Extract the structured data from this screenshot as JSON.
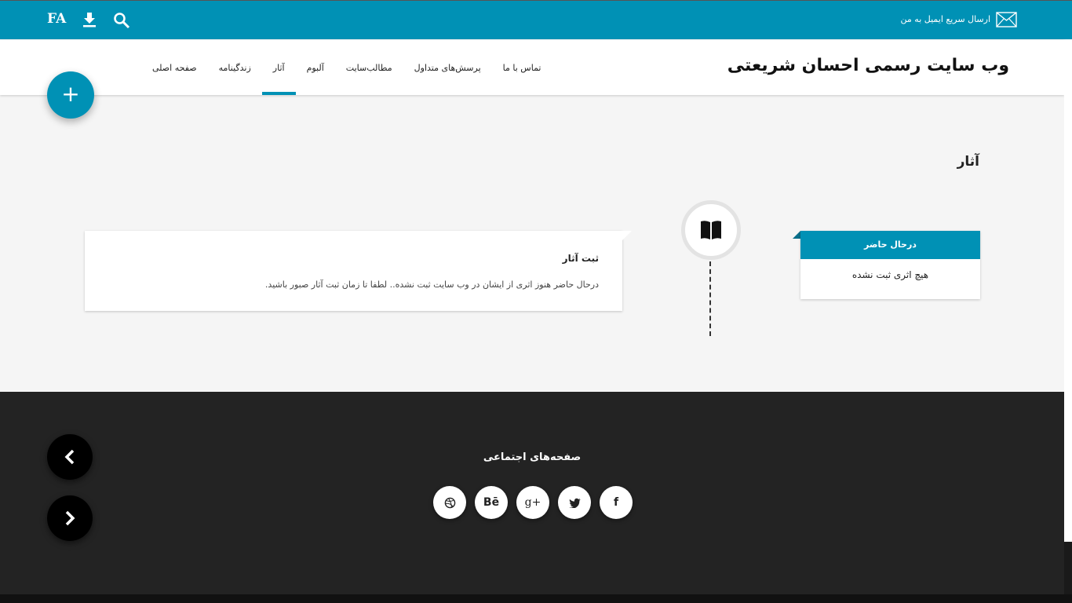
{
  "topbar": {
    "lang_label": "FA",
    "mail_text": "ارسال سریع ایمیل به من",
    "download_icon": "download-icon",
    "search_icon": "search-icon",
    "mail_icon": "envelope-icon"
  },
  "header": {
    "site_title": "وب سایت رسمی احسان شریعتی",
    "nav": [
      {
        "label": "صفحه اصلی",
        "active": false
      },
      {
        "label": "زندگینامه",
        "active": false
      },
      {
        "label": "آثار",
        "active": true
      },
      {
        "label": "آلبوم",
        "active": false
      },
      {
        "label": "مطالب‌سایت",
        "active": false
      },
      {
        "label": "پرسش‌های متداول",
        "active": false
      },
      {
        "label": "تماس با ما",
        "active": false
      }
    ]
  },
  "fab": {
    "label": "+"
  },
  "main": {
    "section_title": "آثار",
    "card": {
      "title": "ثبت آثار",
      "text": "درحال حاضر هنوز اثری از ایشان در وب سایت ثبت نشده.. لطفا تا زمان ثبت آثار صبور باشید."
    },
    "timeline_icon": "book-icon",
    "status": {
      "header": "درحال حاضر",
      "body": "هیچ اثری ثبت نشده"
    }
  },
  "footer": {
    "title": "صفحه‌های اجتماعی",
    "socials": [
      "dribbble-icon",
      "behance-icon",
      "google-plus-icon",
      "twitter-icon",
      "facebook-icon"
    ],
    "behance_label": "Bē",
    "gplus_label": "g+",
    "facebook_label": "f"
  },
  "colors": {
    "accent": "#0091b5",
    "footer_bg": "#232323",
    "page_bg": "#f5f5f5"
  }
}
